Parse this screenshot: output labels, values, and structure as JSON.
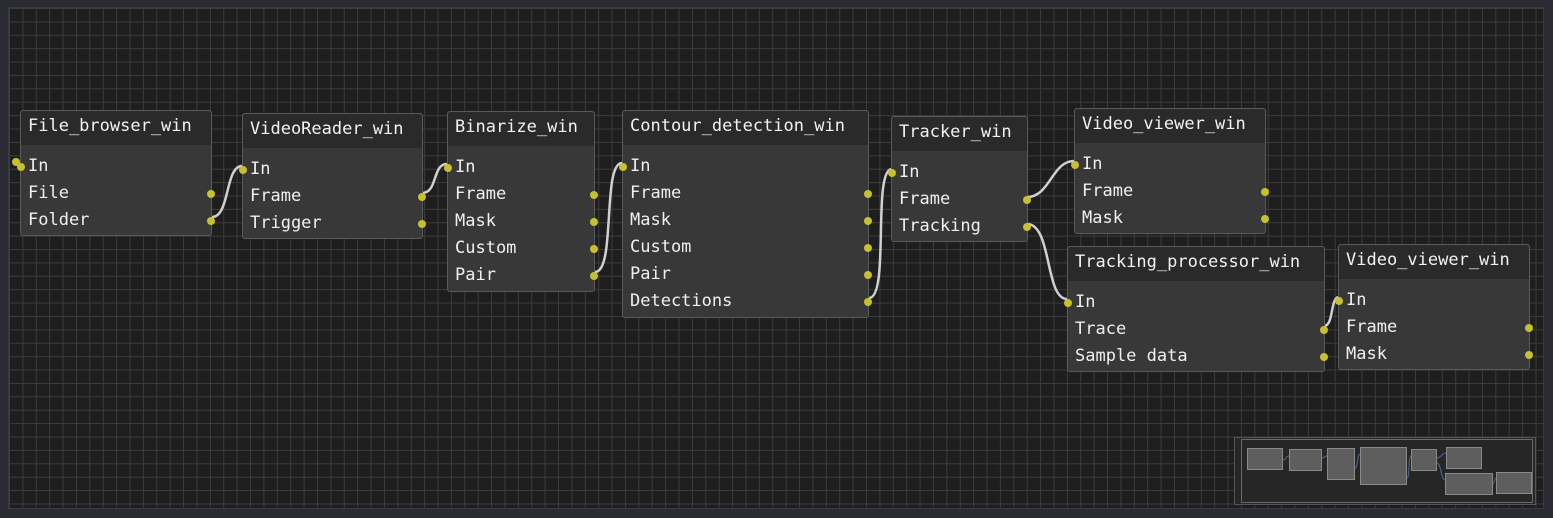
{
  "colors": {
    "background": "#1e1e1e",
    "grid": "#3c3c3c",
    "node": "#383838",
    "title_bar": "#2a2a2a",
    "pin": "#c8c12a",
    "link": "#d0d0d0"
  },
  "nodes": [
    {
      "title": "File_browser_win",
      "ports": [
        "In",
        "File",
        "Folder"
      ]
    },
    {
      "title": "VideoReader_win",
      "ports": [
        "In",
        "Frame",
        "Trigger"
      ]
    },
    {
      "title": "Binarize_win",
      "ports": [
        "In",
        "Frame",
        "Mask",
        "Custom",
        "Pair"
      ]
    },
    {
      "title": "Contour_detection_win",
      "ports": [
        "In",
        "Frame",
        "Mask",
        "Custom",
        "Pair",
        "Detections"
      ]
    },
    {
      "title": "Tracker_win",
      "ports": [
        "In",
        "Frame",
        "Tracking"
      ]
    },
    {
      "title": "Video_viewer_win",
      "ports": [
        "In",
        "Frame",
        "Mask"
      ]
    },
    {
      "title": "Tracking_processor_win",
      "ports": [
        "In",
        "Trace",
        "Sample data"
      ]
    },
    {
      "title": "Video_viewer_win",
      "ports": [
        "In",
        "Frame",
        "Mask"
      ]
    }
  ]
}
